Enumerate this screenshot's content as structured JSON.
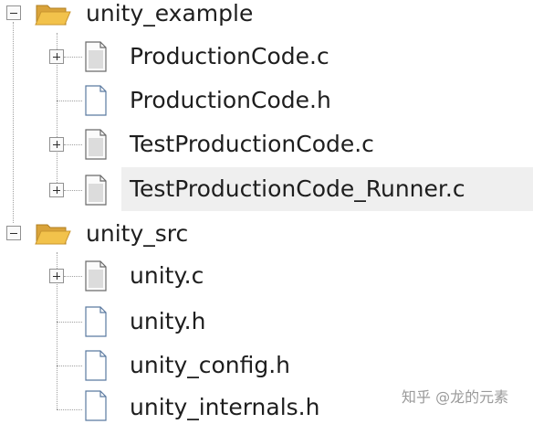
{
  "tree": {
    "root_folder": {
      "label": "unity_example",
      "icon": "open-folder-icon",
      "expanded": true,
      "children": [
        {
          "label": "ProductionCode.c",
          "icon": "c-source-file-icon",
          "expandable": true
        },
        {
          "label": "ProductionCode.h",
          "icon": "header-file-icon",
          "expandable": false
        },
        {
          "label": "TestProductionCode.c",
          "icon": "c-source-file-icon",
          "expandable": true
        },
        {
          "label": "TestProductionCode_Runner.c",
          "icon": "c-source-file-icon",
          "expandable": true,
          "hovered": true
        }
      ]
    },
    "second_folder": {
      "label": "unity_src",
      "icon": "open-folder-icon",
      "expanded": true,
      "children": [
        {
          "label": "unity.c",
          "icon": "c-source-file-icon",
          "expandable": true
        },
        {
          "label": "unity.h",
          "icon": "header-file-icon",
          "expandable": false
        },
        {
          "label": "unity_config.h",
          "icon": "header-file-icon",
          "expandable": false
        },
        {
          "label": "unity_internals.h",
          "icon": "header-file-icon",
          "expandable": false
        }
      ]
    }
  },
  "watermark": "知乎 @龙的元素",
  "colors": {
    "folder_fill": "#f2c24b",
    "folder_dark": "#d9a33a",
    "hover_row": "#efefef",
    "connector": "#a0a0a0",
    "text": "#1e1e1e"
  }
}
